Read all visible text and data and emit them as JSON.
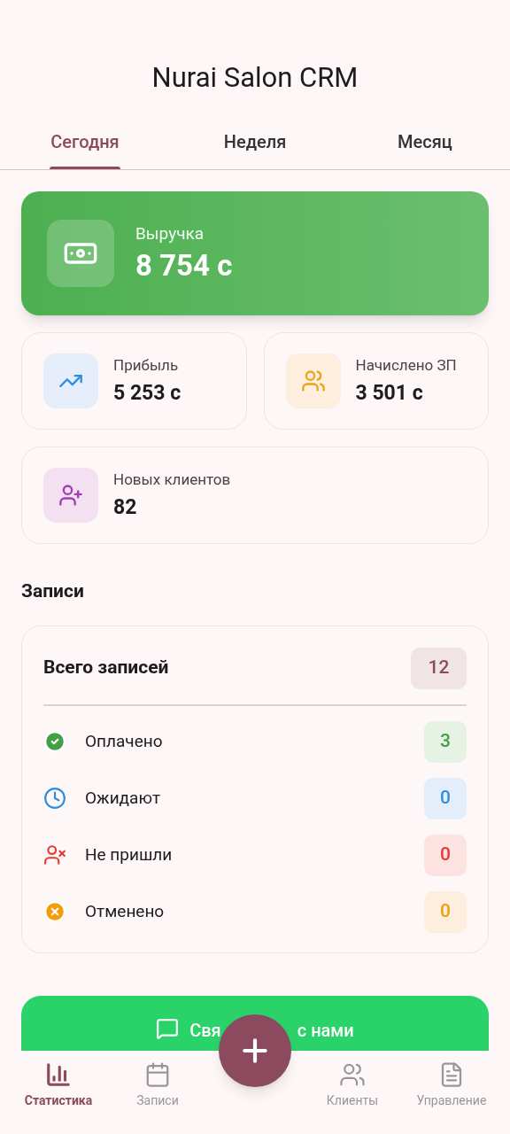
{
  "app_title": "Nurai Salon CRM",
  "tabs": [
    {
      "label": "Сегодня",
      "selected": true
    },
    {
      "label": "Неделя",
      "selected": false
    },
    {
      "label": "Месяц",
      "selected": false
    }
  ],
  "revenue": {
    "label": "Выручка",
    "value": "8 754 с"
  },
  "stats": [
    {
      "kind": "profit",
      "label": "Прибыль",
      "value": "5 253 с"
    },
    {
      "kind": "salary",
      "label": "Начислено ЗП",
      "value": "3 501 с"
    },
    {
      "kind": "clients",
      "label": "Новых клиентов",
      "value": "82"
    }
  ],
  "records": {
    "heading": "Записи",
    "total_label": "Всего записей",
    "total": "12",
    "rows": [
      {
        "kind": "paid",
        "label": "Оплачено",
        "count": "3"
      },
      {
        "kind": "waiting",
        "label": "Ожидают",
        "count": "0"
      },
      {
        "kind": "no_show",
        "label": "Не пришли",
        "count": "0"
      },
      {
        "kind": "cancelled",
        "label": "Отменено",
        "count": "0"
      }
    ]
  },
  "contact_button": {
    "label_parts": [
      "Свя",
      "с нами"
    ]
  },
  "nav": {
    "items": [
      {
        "kind": "stats",
        "label": "Статистика",
        "selected": true
      },
      {
        "kind": "records",
        "label": "Записи",
        "selected": false
      },
      {
        "kind": "clients",
        "label": "Клиенты",
        "selected": false
      },
      {
        "kind": "manage",
        "label": "Управление",
        "selected": false
      }
    ]
  }
}
